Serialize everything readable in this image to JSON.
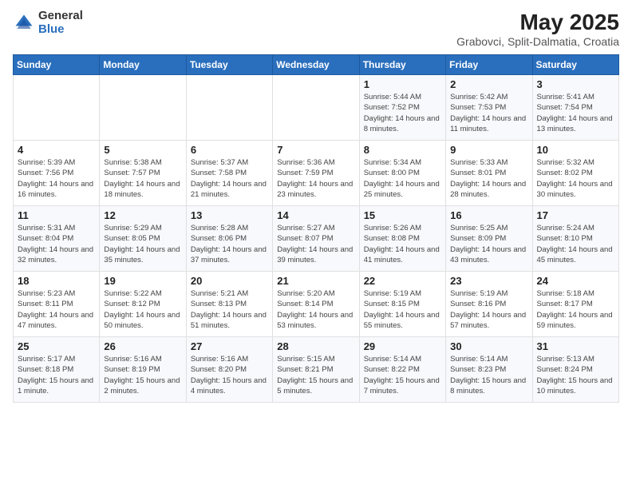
{
  "header": {
    "logo_general": "General",
    "logo_blue": "Blue",
    "title": "May 2025",
    "subtitle": "Grabovci, Split-Dalmatia, Croatia"
  },
  "days_of_week": [
    "Sunday",
    "Monday",
    "Tuesday",
    "Wednesday",
    "Thursday",
    "Friday",
    "Saturday"
  ],
  "weeks": [
    [
      {
        "day": "",
        "detail": ""
      },
      {
        "day": "",
        "detail": ""
      },
      {
        "day": "",
        "detail": ""
      },
      {
        "day": "",
        "detail": ""
      },
      {
        "day": "1",
        "detail": "Sunrise: 5:44 AM\nSunset: 7:52 PM\nDaylight: 14 hours\nand 8 minutes."
      },
      {
        "day": "2",
        "detail": "Sunrise: 5:42 AM\nSunset: 7:53 PM\nDaylight: 14 hours\nand 11 minutes."
      },
      {
        "day": "3",
        "detail": "Sunrise: 5:41 AM\nSunset: 7:54 PM\nDaylight: 14 hours\nand 13 minutes."
      }
    ],
    [
      {
        "day": "4",
        "detail": "Sunrise: 5:39 AM\nSunset: 7:56 PM\nDaylight: 14 hours\nand 16 minutes."
      },
      {
        "day": "5",
        "detail": "Sunrise: 5:38 AM\nSunset: 7:57 PM\nDaylight: 14 hours\nand 18 minutes."
      },
      {
        "day": "6",
        "detail": "Sunrise: 5:37 AM\nSunset: 7:58 PM\nDaylight: 14 hours\nand 21 minutes."
      },
      {
        "day": "7",
        "detail": "Sunrise: 5:36 AM\nSunset: 7:59 PM\nDaylight: 14 hours\nand 23 minutes."
      },
      {
        "day": "8",
        "detail": "Sunrise: 5:34 AM\nSunset: 8:00 PM\nDaylight: 14 hours\nand 25 minutes."
      },
      {
        "day": "9",
        "detail": "Sunrise: 5:33 AM\nSunset: 8:01 PM\nDaylight: 14 hours\nand 28 minutes."
      },
      {
        "day": "10",
        "detail": "Sunrise: 5:32 AM\nSunset: 8:02 PM\nDaylight: 14 hours\nand 30 minutes."
      }
    ],
    [
      {
        "day": "11",
        "detail": "Sunrise: 5:31 AM\nSunset: 8:04 PM\nDaylight: 14 hours\nand 32 minutes."
      },
      {
        "day": "12",
        "detail": "Sunrise: 5:29 AM\nSunset: 8:05 PM\nDaylight: 14 hours\nand 35 minutes."
      },
      {
        "day": "13",
        "detail": "Sunrise: 5:28 AM\nSunset: 8:06 PM\nDaylight: 14 hours\nand 37 minutes."
      },
      {
        "day": "14",
        "detail": "Sunrise: 5:27 AM\nSunset: 8:07 PM\nDaylight: 14 hours\nand 39 minutes."
      },
      {
        "day": "15",
        "detail": "Sunrise: 5:26 AM\nSunset: 8:08 PM\nDaylight: 14 hours\nand 41 minutes."
      },
      {
        "day": "16",
        "detail": "Sunrise: 5:25 AM\nSunset: 8:09 PM\nDaylight: 14 hours\nand 43 minutes."
      },
      {
        "day": "17",
        "detail": "Sunrise: 5:24 AM\nSunset: 8:10 PM\nDaylight: 14 hours\nand 45 minutes."
      }
    ],
    [
      {
        "day": "18",
        "detail": "Sunrise: 5:23 AM\nSunset: 8:11 PM\nDaylight: 14 hours\nand 47 minutes."
      },
      {
        "day": "19",
        "detail": "Sunrise: 5:22 AM\nSunset: 8:12 PM\nDaylight: 14 hours\nand 50 minutes."
      },
      {
        "day": "20",
        "detail": "Sunrise: 5:21 AM\nSunset: 8:13 PM\nDaylight: 14 hours\nand 51 minutes."
      },
      {
        "day": "21",
        "detail": "Sunrise: 5:20 AM\nSunset: 8:14 PM\nDaylight: 14 hours\nand 53 minutes."
      },
      {
        "day": "22",
        "detail": "Sunrise: 5:19 AM\nSunset: 8:15 PM\nDaylight: 14 hours\nand 55 minutes."
      },
      {
        "day": "23",
        "detail": "Sunrise: 5:19 AM\nSunset: 8:16 PM\nDaylight: 14 hours\nand 57 minutes."
      },
      {
        "day": "24",
        "detail": "Sunrise: 5:18 AM\nSunset: 8:17 PM\nDaylight: 14 hours\nand 59 minutes."
      }
    ],
    [
      {
        "day": "25",
        "detail": "Sunrise: 5:17 AM\nSunset: 8:18 PM\nDaylight: 15 hours\nand 1 minute."
      },
      {
        "day": "26",
        "detail": "Sunrise: 5:16 AM\nSunset: 8:19 PM\nDaylight: 15 hours\nand 2 minutes."
      },
      {
        "day": "27",
        "detail": "Sunrise: 5:16 AM\nSunset: 8:20 PM\nDaylight: 15 hours\nand 4 minutes."
      },
      {
        "day": "28",
        "detail": "Sunrise: 5:15 AM\nSunset: 8:21 PM\nDaylight: 15 hours\nand 5 minutes."
      },
      {
        "day": "29",
        "detail": "Sunrise: 5:14 AM\nSunset: 8:22 PM\nDaylight: 15 hours\nand 7 minutes."
      },
      {
        "day": "30",
        "detail": "Sunrise: 5:14 AM\nSunset: 8:23 PM\nDaylight: 15 hours\nand 8 minutes."
      },
      {
        "day": "31",
        "detail": "Sunrise: 5:13 AM\nSunset: 8:24 PM\nDaylight: 15 hours\nand 10 minutes."
      }
    ]
  ]
}
